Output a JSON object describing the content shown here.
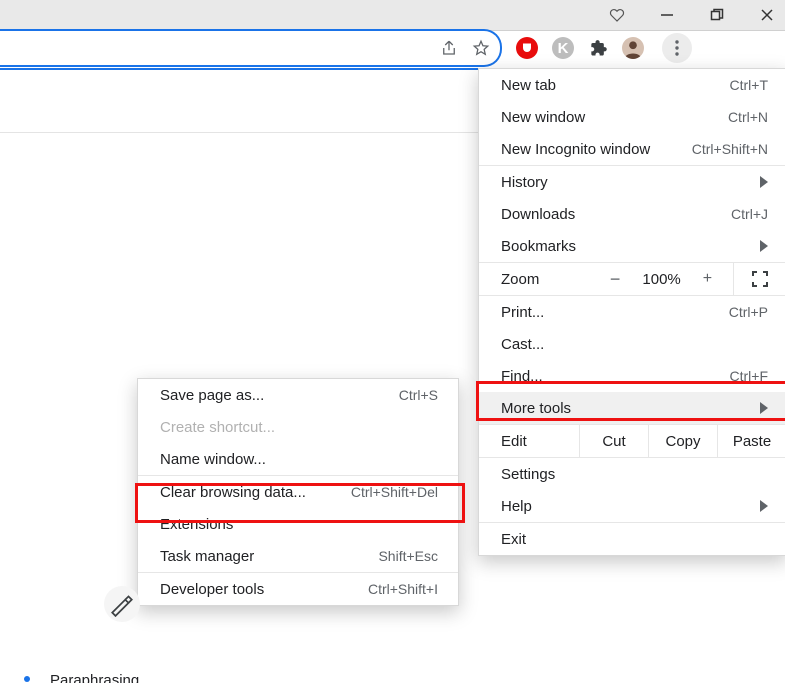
{
  "menu": {
    "new_tab": {
      "label": "New tab",
      "short": "Ctrl+T"
    },
    "new_window": {
      "label": "New window",
      "short": "Ctrl+N"
    },
    "new_incognito": {
      "label": "New Incognito window",
      "short": "Ctrl+Shift+N"
    },
    "history": {
      "label": "History"
    },
    "downloads": {
      "label": "Downloads",
      "short": "Ctrl+J"
    },
    "bookmarks": {
      "label": "Bookmarks"
    },
    "zoom": {
      "label": "Zoom",
      "value": "100%",
      "minus": "−",
      "plus": "+"
    },
    "print": {
      "label": "Print...",
      "short": "Ctrl+P"
    },
    "cast": {
      "label": "Cast..."
    },
    "find": {
      "label": "Find...",
      "short": "Ctrl+F"
    },
    "more_tools": {
      "label": "More tools"
    },
    "edit": {
      "label": "Edit",
      "cut": "Cut",
      "copy": "Copy",
      "paste": "Paste"
    },
    "settings": {
      "label": "Settings"
    },
    "help": {
      "label": "Help"
    },
    "exit": {
      "label": "Exit"
    }
  },
  "submenu": {
    "save_page": {
      "label": "Save page as...",
      "short": "Ctrl+S"
    },
    "create_shortcut": {
      "label": "Create shortcut..."
    },
    "name_window": {
      "label": "Name window..."
    },
    "clear_browsing": {
      "label": "Clear browsing data...",
      "short": "Ctrl+Shift+Del"
    },
    "extensions": {
      "label": "Extensions"
    },
    "task_manager": {
      "label": "Task manager",
      "short": "Shift+Esc"
    },
    "developer_tools": {
      "label": "Developer tools",
      "short": "Ctrl+Shift+I"
    }
  },
  "status_text": "Paraphrasing..."
}
